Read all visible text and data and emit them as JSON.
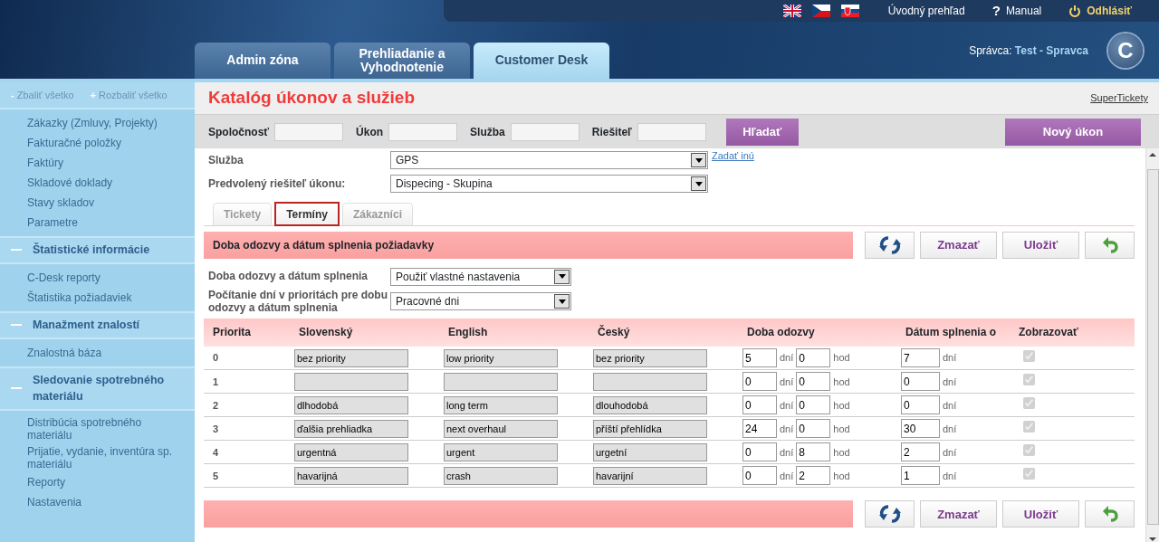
{
  "top_links": [
    {
      "kind": "home",
      "label": "Úvodný prehľad"
    },
    {
      "kind": "help",
      "icon": "?",
      "label": "Manual"
    },
    {
      "kind": "logout",
      "label": "Odhlásiť"
    }
  ],
  "main_tabs": [
    {
      "label": "Admin zóna",
      "selected": false
    },
    {
      "label": "Prehliadanie a Vyhodnotenie",
      "selected": false
    },
    {
      "label": "Customer Desk",
      "selected": true
    }
  ],
  "user": {
    "role_label": "Správca:",
    "name": "Test - Spravca",
    "logo_letter": "C"
  },
  "sidebar": {
    "collapse_all": {
      "icon": "-",
      "label": "Zbaliť všetko"
    },
    "expand_all": {
      "icon": "+",
      "label": "Rozbaliť všetko"
    },
    "groups": [
      {
        "items": [
          "Zákazky (Zmluvy, Projekty)",
          "Fakturačné položky",
          "Faktúry",
          "Skladové doklady",
          "Stavy skladov",
          "Parametre"
        ]
      },
      {
        "title": "Štatistické informácie",
        "expanded": true,
        "items": [
          "C-Desk reporty",
          "Štatistika požiadaviek"
        ]
      },
      {
        "title": "Manažment znalostí",
        "expanded": true,
        "items": [
          "Znalostná báza"
        ]
      },
      {
        "title": "Sledovanie spotrebného materiálu",
        "expanded": true,
        "items": [
          "Distribúcia spotrebného materiálu",
          "Prijatie, vydanie, inventúra sp. materiálu",
          "Reporty",
          "Nastavenia"
        ]
      }
    ]
  },
  "page": {
    "title": "Katalóg úkonov a služieb",
    "link": "SuperTickety"
  },
  "filters": [
    {
      "label": "Spoločnosť"
    },
    {
      "label": "Úkon"
    },
    {
      "label": "Služba"
    },
    {
      "label": "Riešiteľ"
    }
  ],
  "search_button": "Hľadať",
  "new_button": "Nový úkon",
  "form_rows": [
    {
      "label": "Služba",
      "value": "GPS",
      "link": "Zadať inú"
    },
    {
      "label": "Predvolený riešiteľ úkonu:",
      "value": "Dispecing - Skupina"
    }
  ],
  "sub_tabs": [
    {
      "label": "Tickety",
      "selected": false
    },
    {
      "label": "Termíny",
      "selected": true
    },
    {
      "label": "Zákazníci",
      "selected": false
    }
  ],
  "section": {
    "title": "Doba odozvy a dátum splnenia požiadavky",
    "buttons": [
      {
        "kind": "refresh"
      },
      {
        "kind": "text",
        "label": "Zmazať"
      },
      {
        "kind": "text",
        "label": "Uložiť"
      },
      {
        "kind": "undo"
      }
    ]
  },
  "settings": [
    {
      "label": "Doba odozvy a dátum splnenia",
      "value": "Použiť vlastné nastavenia"
    },
    {
      "label": "Počítanie dní v prioritách pre dobu odozvy a dátum splnenia",
      "value": "Pracovné dni"
    }
  ],
  "table": {
    "columns": [
      "Priorita",
      "Slovenský",
      "English",
      "Český",
      "Doba odozvy",
      "Dátum splnenia o",
      "Zobrazovať"
    ],
    "rows": [
      {
        "priority": "0",
        "sk": "bez priority",
        "en": "low priority",
        "cz": "bez priority",
        "response_days": "5",
        "days_unit": "dní",
        "response_hours": "0",
        "hours_unit": "hod",
        "due_days": "7",
        "due_unit": "dní",
        "checked": true,
        "disabled": true
      },
      {
        "priority": "1",
        "response_days": "0",
        "days_unit": "dní",
        "response_hours": "0",
        "hours_unit": "hod",
        "due_days": "0",
        "due_unit": "dní",
        "checked": true,
        "disabled": true
      },
      {
        "priority": "2",
        "sk": "dlhodobá",
        "en": "long term",
        "cz": "dlouhodobá",
        "response_days": "0",
        "days_unit": "dní",
        "response_hours": "0",
        "hours_unit": "hod",
        "due_days": "0",
        "due_unit": "dní",
        "checked": true,
        "disabled": true
      },
      {
        "priority": "3",
        "sk": "ďalšia prehliadka",
        "en": "next overhaul",
        "cz": "příští přehlídka",
        "response_days": "24",
        "days_unit": "dní",
        "response_hours": "0",
        "hours_unit": "hod",
        "due_days": "30",
        "due_unit": "dní",
        "checked": true,
        "disabled": true
      },
      {
        "priority": "4",
        "sk": "urgentná",
        "en": "urgent",
        "cz": "urgetní",
        "response_days": "0",
        "days_unit": "dní",
        "response_hours": "8",
        "hours_unit": "hod",
        "due_days": "2",
        "due_unit": "dní",
        "checked": true,
        "disabled": true
      },
      {
        "priority": "5",
        "sk": "havarijná",
        "en": "crash",
        "cz": "havarijní",
        "response_days": "0",
        "days_unit": "dní",
        "response_hours": "2",
        "hours_unit": "hod",
        "due_days": "1",
        "due_unit": "dní",
        "checked": true,
        "disabled": true
      }
    ]
  },
  "footer_buttons": [
    {
      "kind": "refresh"
    },
    {
      "kind": "text",
      "label": "Zmazať"
    },
    {
      "kind": "text",
      "label": "Uložiť"
    },
    {
      "kind": "undo"
    }
  ]
}
